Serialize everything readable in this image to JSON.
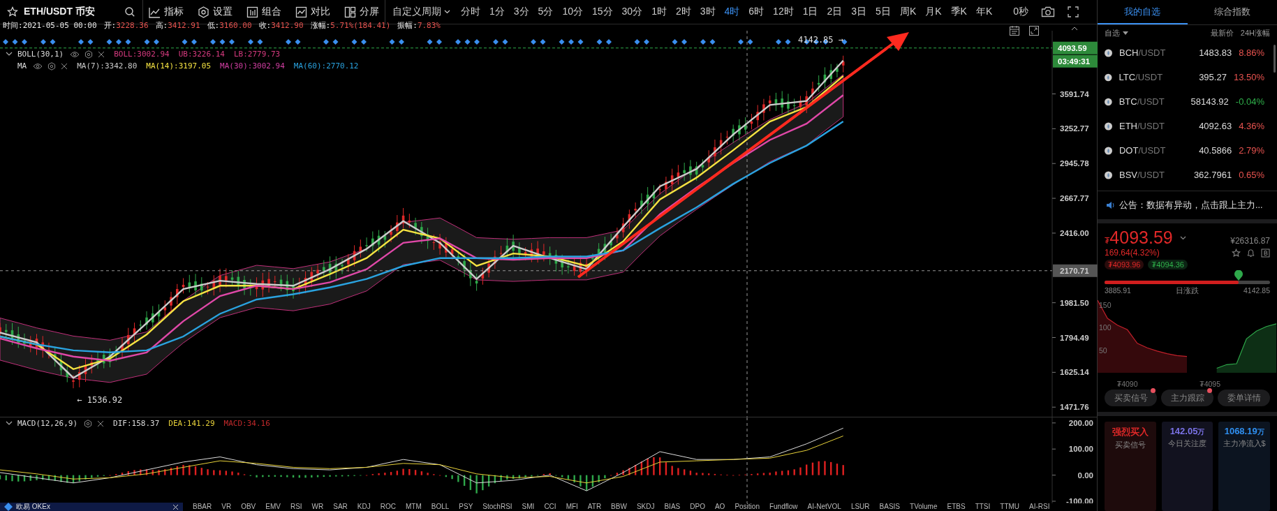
{
  "header": {
    "symbol": "ETH/USDT 币安"
  },
  "tools": [
    {
      "kind": "indicator",
      "label": "指标"
    },
    {
      "kind": "settings",
      "label": "设置"
    },
    {
      "kind": "combo",
      "label": "组合"
    },
    {
      "kind": "compare",
      "label": "对比"
    },
    {
      "kind": "split",
      "label": "分屏"
    }
  ],
  "custom_period": "自定义周期",
  "periods": [
    {
      "label": "分时",
      "selected": false
    },
    {
      "label": "1分",
      "selected": false
    },
    {
      "label": "3分",
      "selected": false
    },
    {
      "label": "5分",
      "selected": false
    },
    {
      "label": "10分",
      "selected": false
    },
    {
      "label": "15分",
      "selected": false
    },
    {
      "label": "30分",
      "selected": false
    },
    {
      "label": "1时",
      "selected": false
    },
    {
      "label": "2时",
      "selected": false
    },
    {
      "label": "3时",
      "selected": false
    },
    {
      "label": "4时",
      "selected": true
    },
    {
      "label": "6时",
      "selected": false
    },
    {
      "label": "12时",
      "selected": false
    },
    {
      "label": "1日",
      "selected": false
    },
    {
      "label": "2日",
      "selected": false
    },
    {
      "label": "3日",
      "selected": false
    },
    {
      "label": "5日",
      "selected": false
    },
    {
      "label": "周K",
      "selected": false
    },
    {
      "label": "月K",
      "selected": false
    },
    {
      "label": "季K",
      "selected": false
    },
    {
      "label": "年K",
      "selected": false
    }
  ],
  "timer": "0秒",
  "info": [
    {
      "label": "时间:",
      "value": "2021-05-05 00:00",
      "kind": "plain"
    },
    {
      "label": "开:",
      "value": "3228.36",
      "kind": "price"
    },
    {
      "label": "高:",
      "value": "3412.91",
      "kind": "price"
    },
    {
      "label": "低:",
      "value": "3160.00",
      "kind": "price"
    },
    {
      "label": "收:",
      "value": "3412.90",
      "kind": "price"
    },
    {
      "label": "涨幅:",
      "value": "5.71%(184.41)",
      "kind": "price"
    },
    {
      "label": "振幅:",
      "value": "7.83%",
      "kind": "price"
    }
  ],
  "legends": [
    {
      "name": "BOLL(30,1)",
      "expand": true,
      "values": [
        {
          "text": "BOLL:3002.94",
          "color": "#d63a7f"
        },
        {
          "text": "UB:3226.14",
          "color": "#d63a7f"
        },
        {
          "text": "LB:2779.73",
          "color": "#d63a7f"
        }
      ]
    },
    {
      "name": "MA",
      "expand": false,
      "values": [
        {
          "text": "MA(7):3342.80",
          "color": "#cccccc"
        },
        {
          "text": "MA(14):3197.05",
          "color": "#f5e342"
        },
        {
          "text": "MA(30):3002.94",
          "color": "#d23fa3"
        },
        {
          "text": "MA(60):2770.12",
          "color": "#2aa3e0"
        }
      ]
    }
  ],
  "chart": {
    "high_label": "4142.85 →",
    "low_label": "← 1536.92",
    "crosshair_label": "2170.71",
    "price_tag": "4093.59",
    "countdown": "03:49:31",
    "axis_labels": [
      "3591.74",
      "3252.77",
      "2945.78",
      "2667.77",
      "2416.00",
      "1981.50",
      "1794.49",
      "1625.14",
      "1471.76"
    ]
  },
  "macd": {
    "name": "MACD(12,26,9)",
    "values": [
      {
        "text": "DIF:158.37",
        "color": "#dddddd"
      },
      {
        "text": "DEA:141.29",
        "color": "#e8d23a"
      },
      {
        "text": "MACD:34.16",
        "color": "#c0282a"
      }
    ],
    "axis_labels": [
      "200.00",
      "100.00",
      "0.00",
      "-100.00"
    ]
  },
  "indicators": [
    "BBAR",
    "VR",
    "OBV",
    "EMV",
    "RSI",
    "WR",
    "SAR",
    "KDJ",
    "ROC",
    "MTM",
    "BOLL",
    "PSY",
    "StochRSI",
    "SMI",
    "CCI",
    "MFI",
    "ATR",
    "BBW",
    "SKDJ",
    "BIAS",
    "DPO",
    "AO",
    "Position",
    "Fundflow",
    "AI-NetVOL",
    "LSUR",
    "BASIS",
    "TVolume",
    "ETBS",
    "TTSI",
    "TTMU",
    "AI-RSI"
  ],
  "ad": {
    "text": "欧易 OKEx"
  },
  "panel": {
    "tabs": [
      {
        "label": "我的自选",
        "selected": true
      },
      {
        "label": "综合指数",
        "selected": false
      }
    ],
    "columns": [
      "自选",
      "最新价",
      "24H涨幅"
    ],
    "rows": [
      {
        "base": "BCH",
        "quote": "/USDT",
        "price": "1483.83",
        "change": "8.86%",
        "up": true
      },
      {
        "base": "LTC",
        "quote": "/USDT",
        "price": "395.27",
        "change": "13.50%",
        "up": true
      },
      {
        "base": "BTC",
        "quote": "/USDT",
        "price": "58143.92",
        "change": "-0.04%",
        "up": false
      },
      {
        "base": "ETH",
        "quote": "/USDT",
        "price": "4092.63",
        "change": "4.36%",
        "up": true
      },
      {
        "base": "DOT",
        "quote": "/USDT",
        "price": "40.5866",
        "change": "2.79%",
        "up": true
      },
      {
        "base": "BSV",
        "quote": "/USDT",
        "price": "362.7961",
        "change": "0.65%",
        "up": true
      }
    ],
    "notice": "公告：数据有异动，点击跟上主力...",
    "quote": {
      "currency": "₮",
      "price": "4093.59",
      "cny": "¥26316.87",
      "change": "169.64(4.32%)",
      "bid": "₮4093.96",
      "ask": "₮4094.36"
    },
    "range": {
      "low": "3885.91",
      "label": "日涨跌",
      "high": "4142.85",
      "level": 0.81
    },
    "depth": {
      "y_labels": [
        "150",
        "100",
        "50"
      ],
      "x_labels": [
        "₮4090",
        "₮4095"
      ]
    },
    "buttons": [
      {
        "label": "买卖信号",
        "dot": true
      },
      {
        "label": "主力跟踪",
        "dot": true
      },
      {
        "label": "委单详情",
        "dot": false
      }
    ],
    "cards": [
      {
        "kind": "signal",
        "value": "强烈买入",
        "label": "买卖信号"
      },
      {
        "kind": "attention",
        "value": "142.05",
        "unit": "万",
        "label": "今日关注度"
      },
      {
        "kind": "inflow",
        "value": "1068.19",
        "unit": "万",
        "label": "主力净流入$"
      }
    ]
  }
}
